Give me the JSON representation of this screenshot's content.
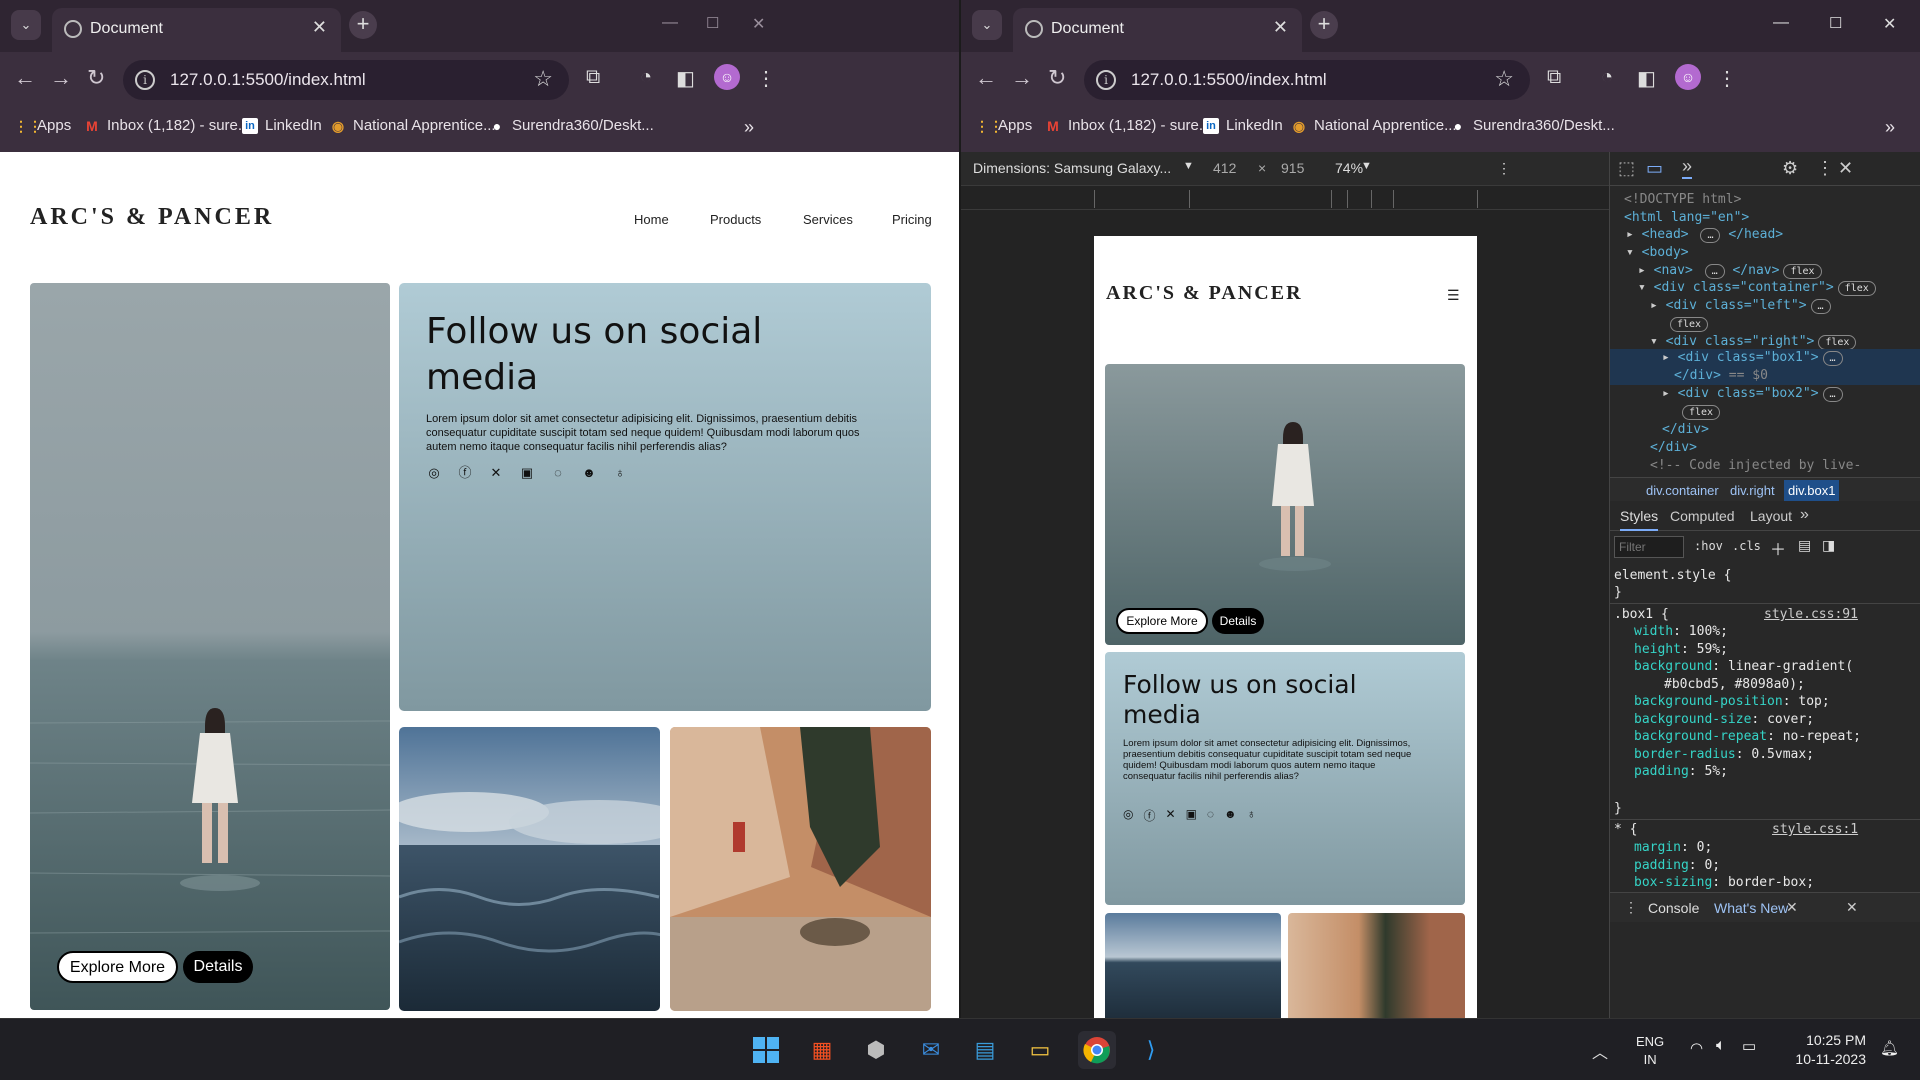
{
  "browser": {
    "tab_title": "Document",
    "new_tab_icon": "+",
    "url": "127.0.0.1:5500/index.html",
    "bookmarks": [
      "Apps",
      "Inbox (1,182) - sure...",
      "LinkedIn",
      "National Apprentice...",
      "Surendra360/Deskt..."
    ],
    "overflow": "»"
  },
  "site": {
    "logo": "ARC'S & PANCER",
    "nav": [
      "Home",
      "Products",
      "Services",
      "Pricing"
    ],
    "heading": "Follow us on social media",
    "body": "Lorem ipsum dolor sit amet consectetur adipisicing elit. Dignissimos, praesentium debitis consequatur cupiditate suscipit totam sed neque quidem! Quibusdam modi laborum quos autem nemo itaque consequatur facilis nihil perferendis alias?",
    "explore": "Explore More",
    "details": "Details",
    "social_icons": [
      "instagram-icon",
      "facebook-icon",
      "x-icon",
      "linkedin-icon",
      "whatsapp-icon",
      "discord-icon",
      "github-icon"
    ]
  },
  "devtools": {
    "dimensions": "Dimensions: Samsung Galaxy...",
    "width": "412",
    "height": "915",
    "zoom": "74%",
    "breadcrumbs": [
      "div.container",
      "div.right",
      "div.box1"
    ],
    "tabs": [
      "Styles",
      "Computed",
      "Layout"
    ],
    "filter_placeholder": "Filter",
    "hov": ":hov",
    "cls": ".cls",
    "element_style": "element.style {",
    "close_brace": "}",
    "rule_selector": ".box1 {",
    "rule_source": "style.css:91",
    "declarations": [
      {
        "prop": "width",
        "val": "100%;"
      },
      {
        "prop": "height",
        "val": "59%;"
      },
      {
        "prop": "background",
        "val": "linear-gradient("
      },
      {
        "prop": "",
        "val": "#b0cbd5, #8098a0);"
      },
      {
        "prop": "background-position",
        "val": "top;"
      },
      {
        "prop": "background-size",
        "val": "cover;"
      },
      {
        "prop": "background-repeat",
        "val": "no-repeat;"
      },
      {
        "prop": "border-radius",
        "val": "0.5vmax;"
      },
      {
        "prop": "padding",
        "val": "5%;"
      }
    ],
    "rule2_selector": "* {",
    "rule2_source": "style.css:1",
    "declarations2": [
      {
        "prop": "margin",
        "val": "0;"
      },
      {
        "prop": "padding",
        "val": "0;"
      },
      {
        "prop": "box-sizing",
        "val": "border-box;"
      }
    ],
    "drawer_tabs": [
      "Console",
      "What's New"
    ],
    "elements": {
      "doctype": "<!DOCTYPE html>",
      "html_open": "<html lang=\"en\">",
      "head": "<head>",
      "head_close": "</head>",
      "body": "<body>",
      "nav": "<nav>",
      "nav_close": "</nav>",
      "container": "<div class=\"container\">",
      "left": "<div class=\"left\">",
      "right": "<div class=\"right\">",
      "box1": "<div class=\"box1\">",
      "div_close": "</div>",
      "selected_marker": "== $0",
      "box2": "<div class=\"box2\">",
      "comment": "<!-- Code injected by live-",
      "ellipsis": "…",
      "flex": "flex"
    }
  },
  "taskbar": {
    "lang_top": "ENG",
    "lang_bottom": "IN",
    "time": "10:25 PM",
    "date": "10-11-2023"
  }
}
